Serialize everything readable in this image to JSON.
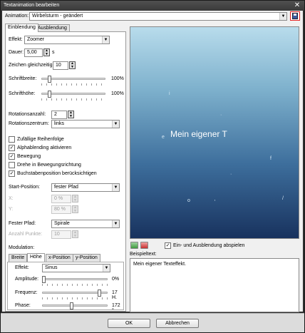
{
  "window": {
    "title": "Textanimation bearbeiten",
    "close_glyph": "✕"
  },
  "animation": {
    "label": "Animation:",
    "selected": "Wirbelsturm - geändert"
  },
  "tabs": {
    "einblendung": "Einblendung",
    "ausblendung": "Ausblendung"
  },
  "form": {
    "effekt_label": "Effekt:",
    "effekt_value": "Zoomer",
    "dauer_label": "Dauer:",
    "dauer_value": "5,00",
    "dauer_unit": "s",
    "zeichen_label": "Zeichen gleichzeitig:",
    "zeichen_value": "10",
    "schriftbreite_label": "Schriftbreite:",
    "schriftbreite_pct": "100%",
    "schriftbreite_level": 0.1,
    "schrifthoehe_label": "Schrifthöhe:",
    "schrifthoehe_pct": "100%",
    "schrifthoehe_level": 0.1,
    "rotationsanzahl_label": "Rotationsanzahl:",
    "rotationsanzahl_value": "2",
    "rotationszentrum_label": "Rotationszentrum:",
    "rotationszentrum_value": "links"
  },
  "checkboxes": [
    {
      "label": "Zufällige Reihenfolge",
      "checked": false
    },
    {
      "label": "Alphablending aktivieren",
      "checked": true
    },
    {
      "label": "Bewegung",
      "checked": true
    },
    {
      "label": "Drehe in Bewegungsrichtung",
      "checked": false
    },
    {
      "label": "Buchstabenposition berücksichtigen",
      "checked": true
    }
  ],
  "position": {
    "start_label": "Start-Position:",
    "start_value": "fester Pfad",
    "x_label": "X:",
    "x_value": "0 %",
    "y_label": "Y:",
    "y_value": "80 %",
    "pfad_label": "Fester Pfad:",
    "pfad_value": "Spirale",
    "punkte_label": "Anzahl Punkte:",
    "punkte_value": "10"
  },
  "modulation": {
    "label": "Modulation:",
    "tabs": [
      "Breite",
      "Höhe",
      "x-Position",
      "y-Position"
    ],
    "active_tab": "Höhe",
    "effekt_label": "Effekt:",
    "effekt_value": "Sinus",
    "amplitude_label": "Amplitude:",
    "amplitude_pct": "0%",
    "amplitude_level": 0.0,
    "frequenz_label": "Frequenz:",
    "frequenz_pct": "17 H.",
    "frequenz_level": 0.9,
    "phase_label": "Phase:",
    "phase_pct": "172 °",
    "phase_level": 0.45
  },
  "preview": {
    "text": "Mein eigener T",
    "playback_label": "Ein- und Ausblendung abspielen",
    "playback_checked": true
  },
  "beispiel": {
    "label": "Beispieltext:",
    "text": "Mein eigener Texteffekt."
  },
  "buttons": {
    "ok": "OK",
    "cancel": "Abbrechen"
  },
  "colors": {
    "accent_border": "#e02020",
    "preview_top": "#b8dcec",
    "preview_bottom": "#18325e"
  }
}
